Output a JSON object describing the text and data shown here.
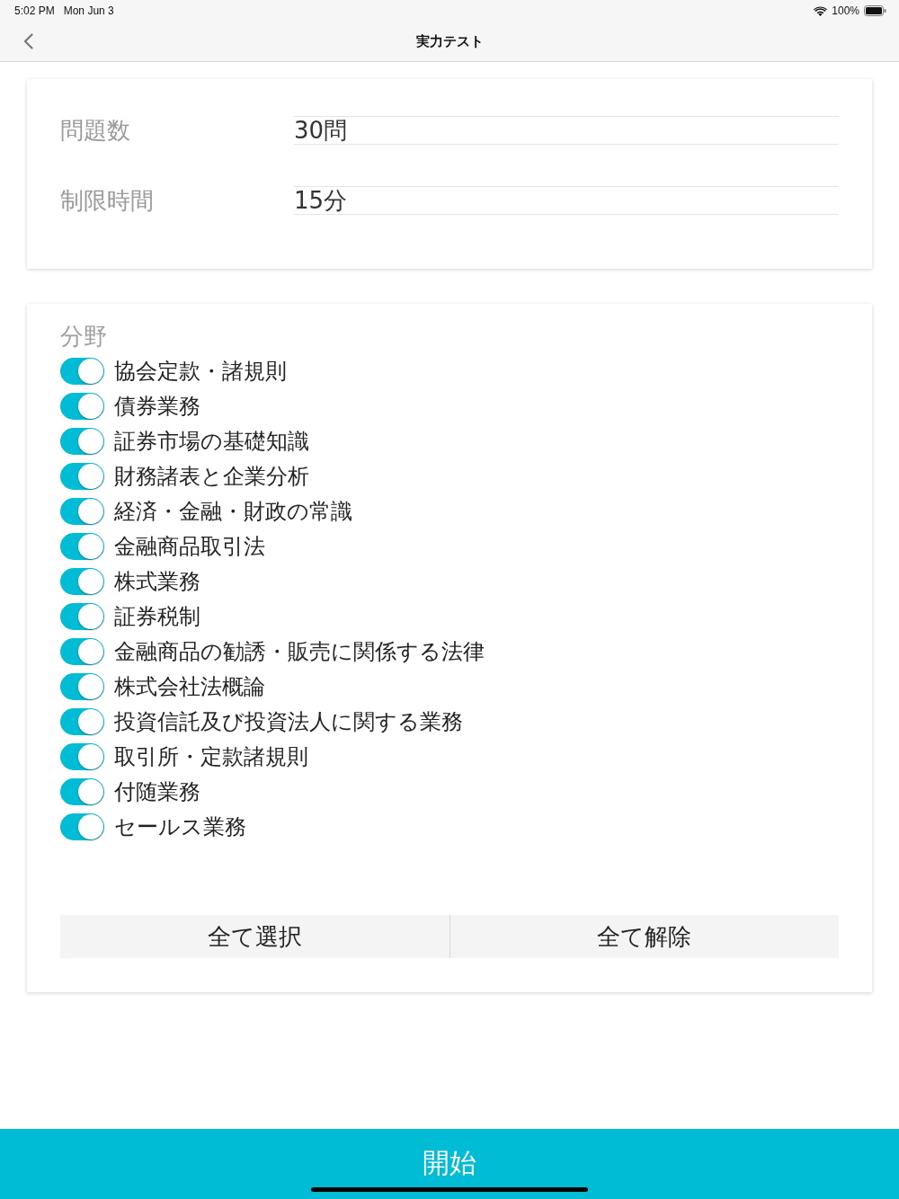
{
  "status_bar": {
    "time": "5:02 PM",
    "date": "Mon Jun 3",
    "battery": "100%"
  },
  "nav": {
    "title": "実力テスト"
  },
  "settings": [
    {
      "label": "問題数",
      "value": "30問"
    },
    {
      "label": "制限時間",
      "value": "15分"
    }
  ],
  "categories": {
    "title": "分野",
    "items": [
      {
        "label": "協会定款・諸規則",
        "on": true
      },
      {
        "label": "債券業務",
        "on": true
      },
      {
        "label": "証券市場の基礎知識",
        "on": true
      },
      {
        "label": "財務諸表と企業分析",
        "on": true
      },
      {
        "label": "経済・金融・財政の常識",
        "on": true
      },
      {
        "label": "金融商品取引法",
        "on": true
      },
      {
        "label": "株式業務",
        "on": true
      },
      {
        "label": "証券税制",
        "on": true
      },
      {
        "label": "金融商品の勧誘・販売に関係する法律",
        "on": true
      },
      {
        "label": "株式会社法概論",
        "on": true
      },
      {
        "label": "投資信託及び投資法人に関する業務",
        "on": true
      },
      {
        "label": "取引所・定款諸規則",
        "on": true
      },
      {
        "label": "付随業務",
        "on": true
      },
      {
        "label": "セールス業務",
        "on": true
      }
    ]
  },
  "buttons": [
    "全て選択",
    "全て解除"
  ],
  "start_button": "開始"
}
